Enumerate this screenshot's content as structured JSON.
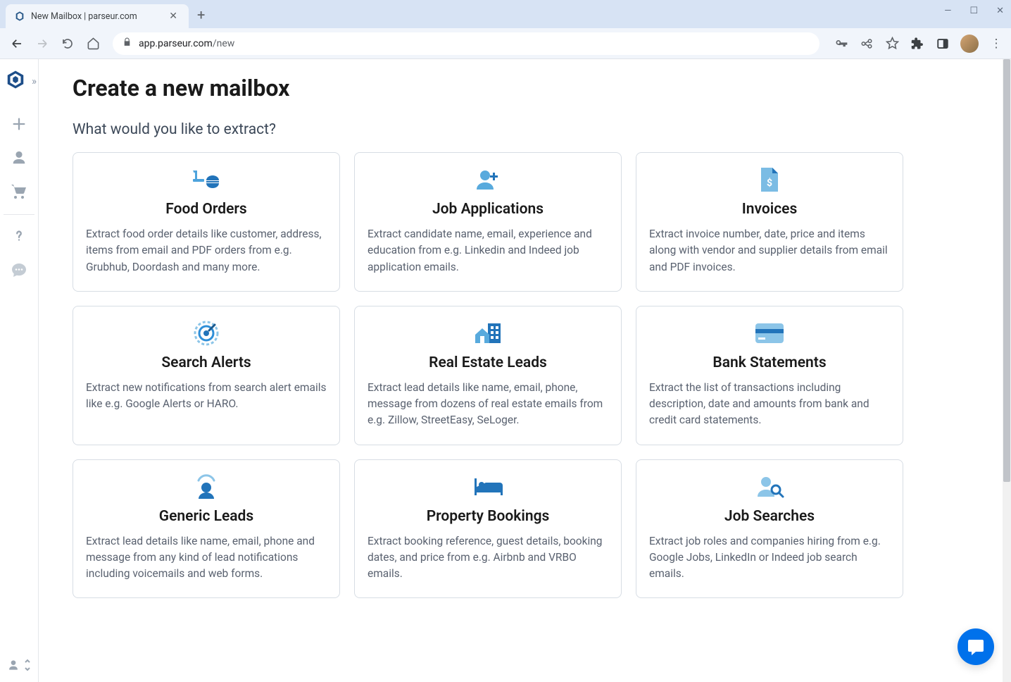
{
  "browser": {
    "tab_title": "New Mailbox | parseur.com",
    "url_prefix": "app.parseur.com",
    "url_path": "/new"
  },
  "page": {
    "title": "Create a new mailbox",
    "subtitle": "What would you like to extract?"
  },
  "cards": [
    {
      "icon": "food-icon",
      "title": "Food Orders",
      "desc": "Extract food order details like customer, address, items from email and PDF orders from e.g. Grubhub, Doordash and many more."
    },
    {
      "icon": "job-application-icon",
      "title": "Job Applications",
      "desc": "Extract candidate name, email, experience and education from e.g. Linkedin and Indeed job application emails."
    },
    {
      "icon": "invoice-icon",
      "title": "Invoices",
      "desc": "Extract invoice number, date, price and items along with vendor and supplier details from email and PDF invoices."
    },
    {
      "icon": "search-alert-icon",
      "title": "Search Alerts",
      "desc": "Extract new notifications from search alert emails like e.g. Google Alerts or HARO."
    },
    {
      "icon": "real-estate-icon",
      "title": "Real Estate Leads",
      "desc": "Extract lead details like name, email, phone, message from dozens of real estate emails from e.g. Zillow, StreetEasy, SeLoger."
    },
    {
      "icon": "bank-icon",
      "title": "Bank Statements",
      "desc": "Extract the list of transactions including description, date and amounts from bank and credit card statements."
    },
    {
      "icon": "generic-lead-icon",
      "title": "Generic Leads",
      "desc": "Extract lead details like name, email, phone and message from any kind of lead notifications including voicemails and web forms."
    },
    {
      "icon": "booking-icon",
      "title": "Property Bookings",
      "desc": "Extract booking reference, guest details, booking dates, and price from e.g. Airbnb and VRBO emails."
    },
    {
      "icon": "job-search-icon",
      "title": "Job Searches",
      "desc": "Extract job roles and companies hiring from e.g. Google Jobs, LinkedIn or Indeed job search emails."
    }
  ]
}
